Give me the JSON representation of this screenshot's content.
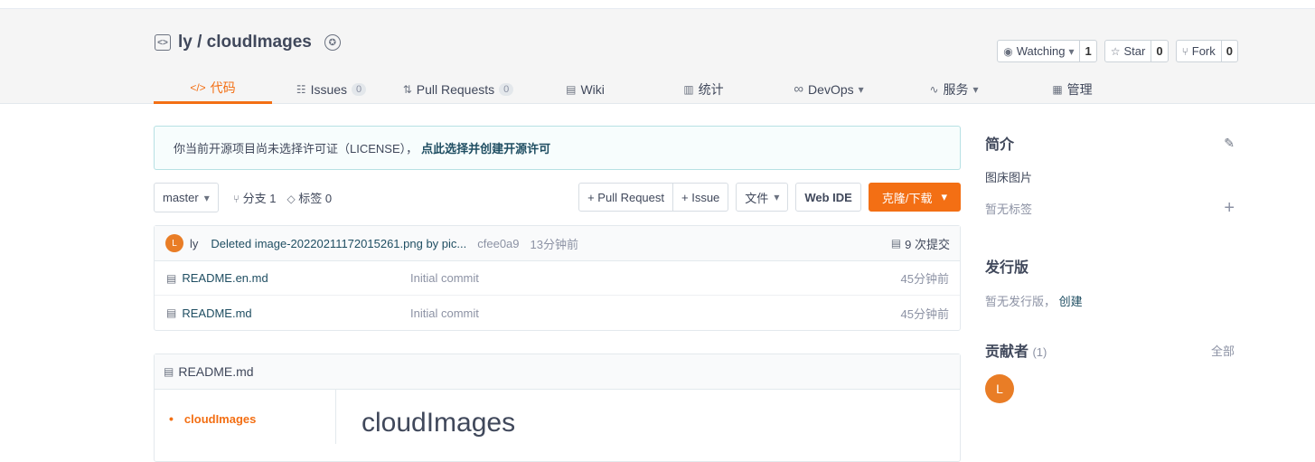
{
  "repo": {
    "title": "ly / cloudImages"
  },
  "actions": [
    {
      "label": "Watching",
      "count": "1"
    },
    {
      "label": "Star",
      "count": "0"
    },
    {
      "label": "Fork",
      "count": "0"
    }
  ],
  "tabs": [
    {
      "label": "代码",
      "icon": "code-icon"
    },
    {
      "label": "Issues",
      "count": "0",
      "icon": "issues-icon"
    },
    {
      "label": "Pull Requests",
      "count": "0",
      "icon": "pull-request-icon"
    },
    {
      "label": "Wiki",
      "icon": "wiki-icon"
    },
    {
      "label": "统计",
      "icon": "stats-icon"
    },
    {
      "label": "DevOps",
      "icon": "devops-icon"
    },
    {
      "label": "服务",
      "icon": "service-icon"
    },
    {
      "label": "管理",
      "icon": "manage-icon"
    }
  ],
  "notice": {
    "text": "你当前开源项目尚未选择许可证（LICENSE），",
    "link": "点此选择并创建开源许可"
  },
  "toolbar": {
    "branch": "master",
    "branches": "分支 1",
    "tags": "标签 0",
    "pull_request": "+ Pull Request",
    "issue": "+ Issue",
    "files": "文件",
    "webide": "Web IDE",
    "clone": "克隆/下载"
  },
  "commit": {
    "avatar": "L",
    "author": "ly",
    "message": "Deleted image-20220211172015261.png by pic...",
    "sha": "cfee0a9",
    "time": "13分钟前",
    "count": "9 次提交"
  },
  "files": [
    {
      "name": "README.en.md",
      "message": "Initial commit",
      "time": "45分钟前"
    },
    {
      "name": "README.md",
      "message": "Initial commit",
      "time": "45分钟前"
    }
  ],
  "readme": {
    "filename": "README.md",
    "toc_item": "cloudImages",
    "title": "cloudImages"
  },
  "sidebar": {
    "intro_title": "简介",
    "intro_text": "图床图片",
    "no_tags": "暂无标签",
    "release_title": "发行版",
    "release_text": "暂无发行版，",
    "release_link": "创建",
    "contrib_title": "贡献者",
    "contrib_count": "(1)",
    "contrib_all": "全部",
    "contrib_avatar": "L"
  },
  "colors": {
    "accent": "#f36f14",
    "link": "#1f4e62",
    "avatar": "#e97d26"
  }
}
